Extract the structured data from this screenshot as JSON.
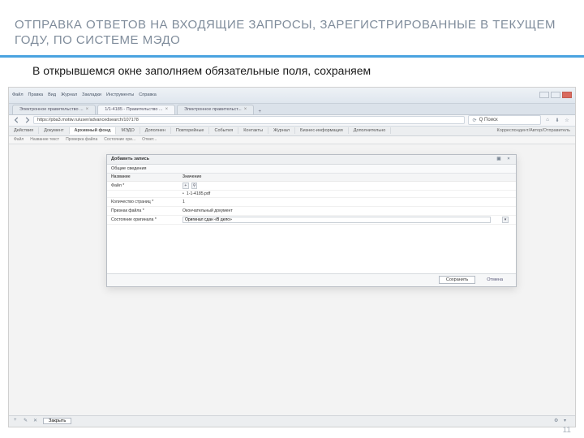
{
  "slide": {
    "title": "ОТПРАВКА ОТВЕТОВ НА ВХОДЯЩИЕ ЗАПРОСЫ, ЗАРЕГИСТРИРОВАННЫЕ В ТЕКУЩЕМ ГОДУ, ПО СИСТЕМЕ МЭДО",
    "subtitle": "В открывшемся окне заполняем обязательные поля, сохраняем",
    "page": "11"
  },
  "os_menu": [
    "Файл",
    "Правка",
    "Вид",
    "Журнал",
    "Закладки",
    "Инструменты",
    "Справка"
  ],
  "tabs": [
    {
      "label": "Электронное правительство ...",
      "active": false
    },
    {
      "label": "1/1-4185 - Правительство ...",
      "active": true
    },
    {
      "label": "Электронное правительст...",
      "active": false
    }
  ],
  "address_bar": {
    "url": "https://pba3.motiw.ru/user/advancedsearch/107178",
    "search_placeholder": "Поиск"
  },
  "app_tabs": [
    "Действия",
    "Документ",
    "Архивный фонд",
    "МЭДО",
    "Дополнен",
    "Повторейные",
    "События",
    "Контакты",
    "Журнал",
    "Бизнес-информация",
    "Дополнительно"
  ],
  "app_tabs_active_index": 2,
  "app_right": "Корреспондент/Автор/Отправитель",
  "subbar": [
    "Файл",
    "Название текст",
    "Проверка файла",
    "Состояние ори...",
    "Отмет..."
  ],
  "dialog": {
    "title": "Добавить запись",
    "subtab": "Общие сведения",
    "header_left": "Название",
    "header_right": "Значение",
    "rows": [
      {
        "label": "Файл *",
        "value": "1-1-4185.pdf",
        "type": "file"
      },
      {
        "label": "Количество страниц *",
        "value": "1",
        "type": "text"
      },
      {
        "label": "Признак файла *",
        "value": "Окончательный документ",
        "type": "text"
      },
      {
        "label": "Состояние оригинала *",
        "value": "Оригинал сдан «В дело»",
        "type": "input"
      }
    ],
    "save": "Сохранить",
    "cancel": "Отмена"
  },
  "bottom": {
    "back": "Закрыть"
  }
}
